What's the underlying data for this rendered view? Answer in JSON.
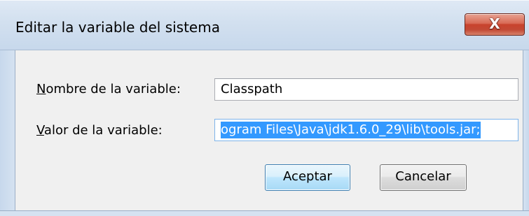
{
  "window": {
    "title": "Editar la variable del sistema",
    "close_glyph": "X",
    "close_icon": "close-icon",
    "accent_close": "#c9432d"
  },
  "form": {
    "name_label_accel": "N",
    "name_label_rest": "ombre de la variable:",
    "name_value": "Classpath",
    "value_label_accel": "V",
    "value_label_rest": "alor de la variable:",
    "value_value": "ogram Files\\Java\\jdk1.6.0_29\\lib\\tools.jar;",
    "selection_color": "#3399ff"
  },
  "buttons": {
    "ok_label": "Aceptar",
    "cancel_label": "Cancelar"
  }
}
